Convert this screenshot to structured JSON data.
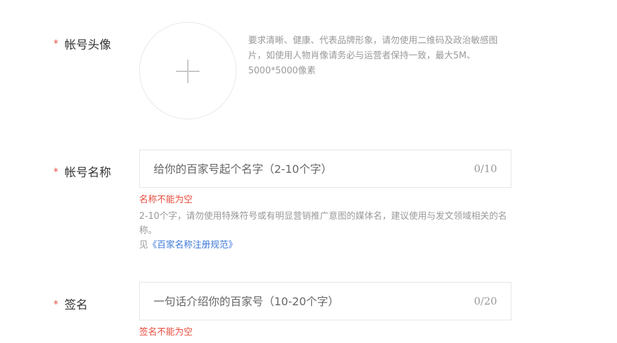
{
  "required_mark": "*",
  "avatar": {
    "label": "帐号头像",
    "hint": "要求清晰、健康、代表品牌形象，请勿使用二维码及政治敏感图片，如使用人物肖像请务必与运营者保持一致，最大5M、5000*5000像素"
  },
  "account_name": {
    "label": "帐号名称",
    "placeholder": "给你的百家号起个名字（2-10个字）",
    "value": "",
    "counter": "0/10",
    "error": "名称不能为空",
    "tip": "2-10个字，请勿使用特殊符号或有明显营销推广意图的媒体名，建议使用与发文领域相关的名称。",
    "see_prefix": "见",
    "link": "《百家名称注册规范》"
  },
  "signature": {
    "label": "签名",
    "placeholder": "一句话介绍你的百家号（10-20个字）",
    "value": "",
    "counter": "0/20",
    "error": "签名不能为空"
  },
  "colors": {
    "required": "#e64c3c",
    "error": "#e64c3c",
    "link": "#3c78d8",
    "hint": "#999999"
  },
  "icons": [
    "plus-icon"
  ]
}
